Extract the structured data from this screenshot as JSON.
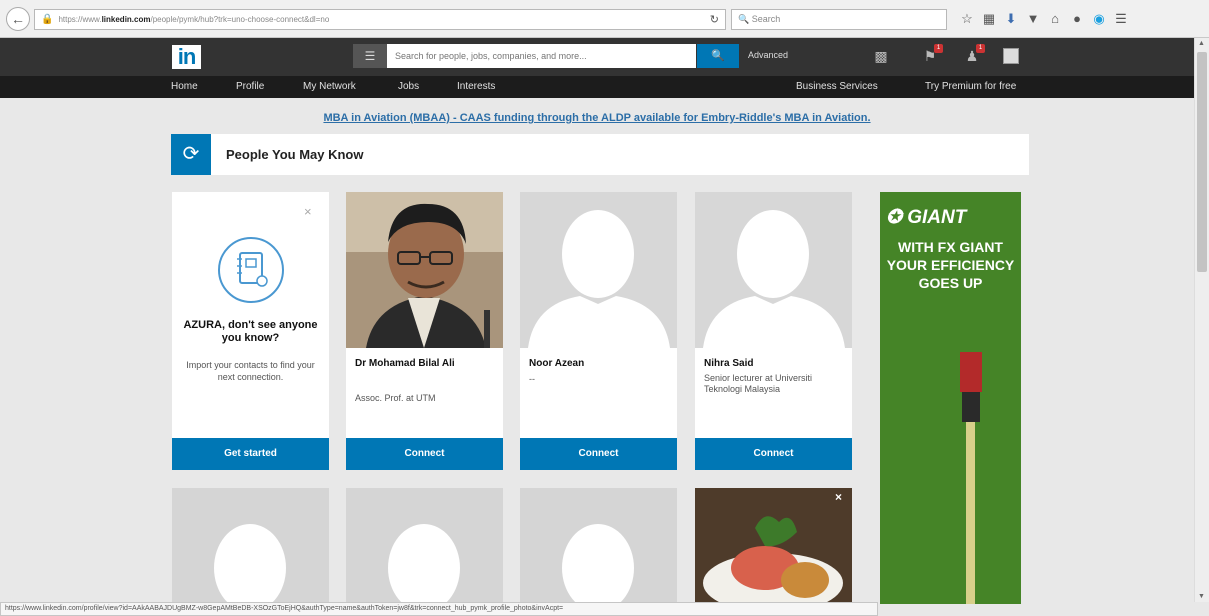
{
  "browser": {
    "url_prefix": "https://www.",
    "url_domain": "linkedin.com",
    "url_path": "/people/pymk/hub?trk=uno-choose-connect&dl=no",
    "search_placeholder": "Search",
    "status_url": "https://www.linkedin.com/profile/view?id=AAkAABAJDUgBMZ-w8GepAMtBeDB-XSOzGToEjHQ&authType=name&authToken=jw8f&trk=connect_hub_pymk_profile_photo&invAcpt="
  },
  "header": {
    "logo": "in",
    "search_placeholder": "Search for people, jobs, companies, and more...",
    "advanced_label": "Advanced",
    "badges": {
      "flag": "1",
      "add_connection": "1"
    }
  },
  "nav": {
    "items": [
      "Home",
      "Profile",
      "My Network",
      "Jobs",
      "Interests"
    ],
    "right_items": [
      "Business Services",
      "Try Premium for free"
    ]
  },
  "ad_line": "MBA in Aviation (MBAA) - CAAS funding through the ALDP available for Embry-Riddle's MBA in Aviation.",
  "pymk": {
    "title": "People You May Know",
    "import_card": {
      "close": "×",
      "title": "AZURA, don't see anyone you know?",
      "text": "Import your contacts to find your next connection.",
      "button": "Get started"
    },
    "people": [
      {
        "name": "Dr Mohamad Bilal Ali",
        "headline": "Assoc. Prof. at UTM",
        "button": "Connect"
      },
      {
        "name": "Noor Azean",
        "headline": "--",
        "button": "Connect"
      },
      {
        "name": "Nihra Said",
        "headline": "Senior lecturer at Universiti Teknologi Malaysia",
        "button": "Connect"
      }
    ]
  },
  "ad": {
    "brand": "GIANT",
    "copy": "WITH FX GIANT YOUR EFFICIENCY GOES UP"
  }
}
